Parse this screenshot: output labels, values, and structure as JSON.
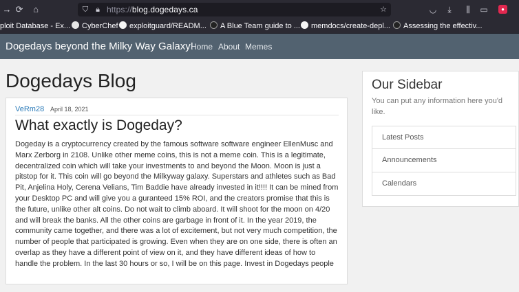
{
  "browser": {
    "url_dim": "https://",
    "url_host": "blog.dogedays.ca",
    "bookmarks": [
      "ploit Database - Ex...",
      "CyberChef",
      "exploitguard/READM...",
      "A Blue Team guide to ...",
      "memdocs/create-depl...",
      "Assessing the effectiv..."
    ]
  },
  "navbar": {
    "brand": "Dogedays beyond the Milky Way Galaxy!",
    "links": [
      "Home",
      "About",
      "Memes"
    ]
  },
  "page": {
    "title": "Dogedays Blog"
  },
  "post": {
    "author": "VeRm28",
    "date": "April 18, 2021",
    "title": "What exactly is Dogeday?",
    "body": "Dogeday is a cryptocurrency created by the famous software software engineer EllenMusc and Marx Zerborg in 2108. Unlike other meme coins, this is not a meme coin. This is a legitimate, decentralized coin which will take your investments to and beyond the Moon. Moon is just a pitstop for it. This coin will go beyond the Milkyway galaxy. Superstars and athletes such as Bad Pit, Anjelina Holy, Cerena Velians, Tim Baddie have already invested in it!!!! It can be mined from your Desktop PC and will give you a guranteed 15% ROI, and the creators promise that this is the future, unlike other alt coins. Do not wait to climb aboard. It will shoot for the moon on 4/20 and will break the banks. All the other coins are garbage in front of it. In the year 2019, the community came together, and there was a lot of excitement, but not very much competition, the number of people that participated is growing. Even when they are on one side, there is often an overlap as they have a different point of view on it, and they have different ideas of how to handle the problem. In the last 30 hours or so, I will be on this page. Invest in Dogedays people"
  },
  "sidebar": {
    "title": "Our Sidebar",
    "description": "You can put any information here you'd like.",
    "items": [
      "Latest Posts",
      "Announcements",
      "Calendars"
    ]
  }
}
